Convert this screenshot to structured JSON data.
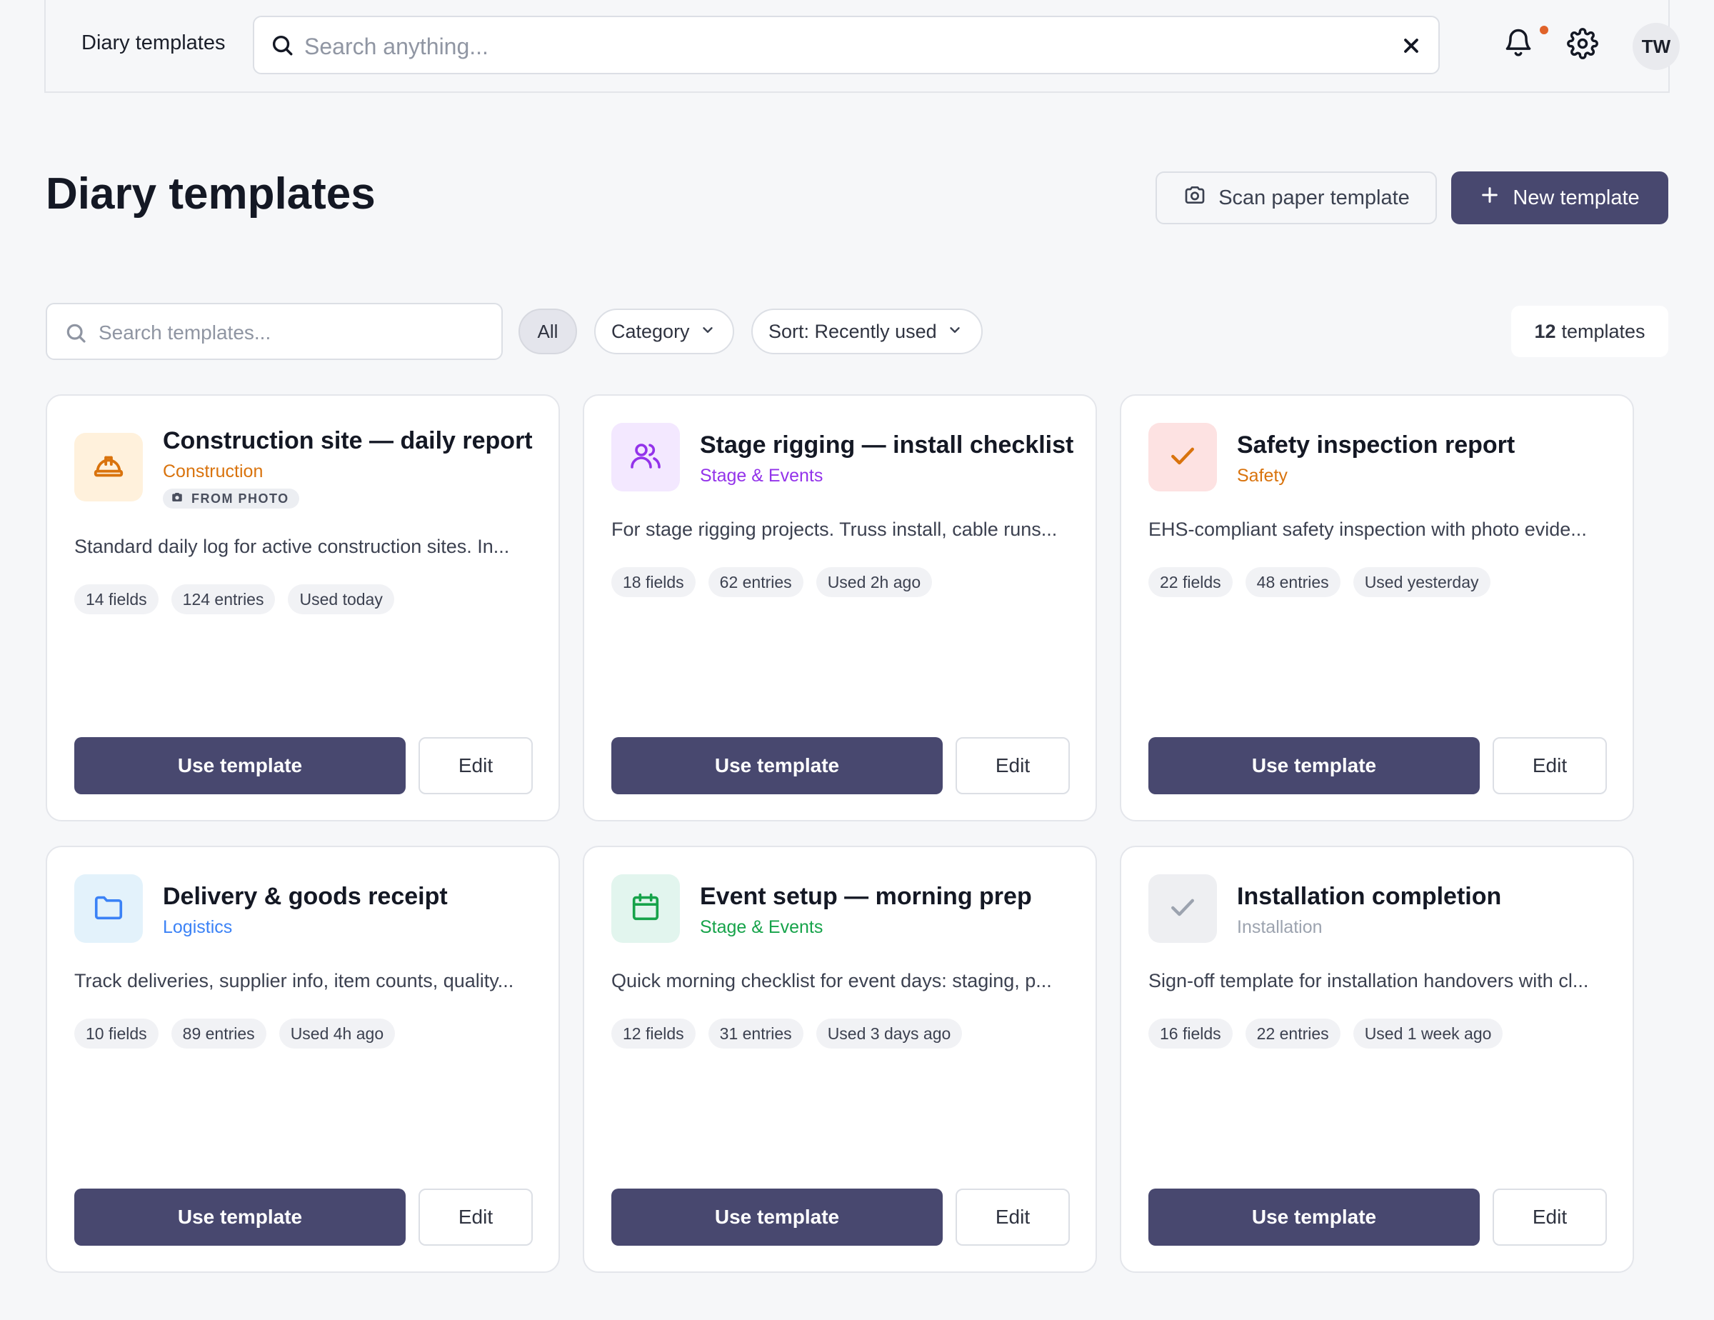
{
  "topbar": {
    "title": "Diary templates",
    "search_placeholder": "Search anything...",
    "avatar_initials": "TW",
    "notification_dot_color": "#e0632a"
  },
  "header": {
    "title": "Diary templates",
    "scan_label": "Scan paper template",
    "new_label": "New template"
  },
  "filters": {
    "search_placeholder": "Search templates...",
    "all_label": "All",
    "category_label": "Category",
    "sort_label": "Sort: Recently used",
    "count": "12",
    "count_label": "templates"
  },
  "colors": {
    "primary": "#48486f",
    "background": "#f6f7f9"
  },
  "cards": [
    {
      "title": "Construction site — daily report",
      "category": "Construction",
      "category_color": "#d9730d",
      "icon": "hard-hat-icon",
      "badge": "FROM PHOTO",
      "description": "Standard daily log for active construction sites. In...",
      "fields": "14 fields",
      "entries": "124 entries",
      "used": "Used today",
      "use_label": "Use template",
      "edit_label": "Edit"
    },
    {
      "title": "Stage rigging — install checklist",
      "category": "Stage & Events",
      "category_color": "#9333ea",
      "icon": "users-icon",
      "description": "For stage rigging projects. Truss install, cable runs...",
      "fields": "18 fields",
      "entries": "62 entries",
      "used": "Used 2h ago",
      "use_label": "Use template",
      "edit_label": "Edit"
    },
    {
      "title": "Safety inspection report",
      "category": "Safety",
      "category_color": "#d9730d",
      "icon": "check-icon",
      "description": "EHS-compliant safety inspection with photo evide...",
      "fields": "22 fields",
      "entries": "48 entries",
      "used": "Used yesterday",
      "use_label": "Use template",
      "edit_label": "Edit"
    },
    {
      "title": "Delivery & goods receipt",
      "category": "Logistics",
      "category_color": "#3b82f6",
      "icon": "folder-icon",
      "description": "Track deliveries, supplier info, item counts, quality...",
      "fields": "10 fields",
      "entries": "89 entries",
      "used": "Used 4h ago",
      "use_label": "Use template",
      "edit_label": "Edit"
    },
    {
      "title": "Event setup — morning prep",
      "category": "Stage & Events",
      "category_color": "#16a34a",
      "icon": "calendar-icon",
      "description": "Quick morning checklist for event days: staging, p...",
      "fields": "12 fields",
      "entries": "31 entries",
      "used": "Used 3 days ago",
      "use_label": "Use template",
      "edit_label": "Edit"
    },
    {
      "title": "Installation completion",
      "category": "Installation",
      "category_color": "#9ca3af",
      "icon": "check-icon",
      "description": "Sign-off template for installation handovers with cl...",
      "fields": "16 fields",
      "entries": "22 entries",
      "used": "Used 1 week ago",
      "use_label": "Use template",
      "edit_label": "Edit"
    }
  ]
}
